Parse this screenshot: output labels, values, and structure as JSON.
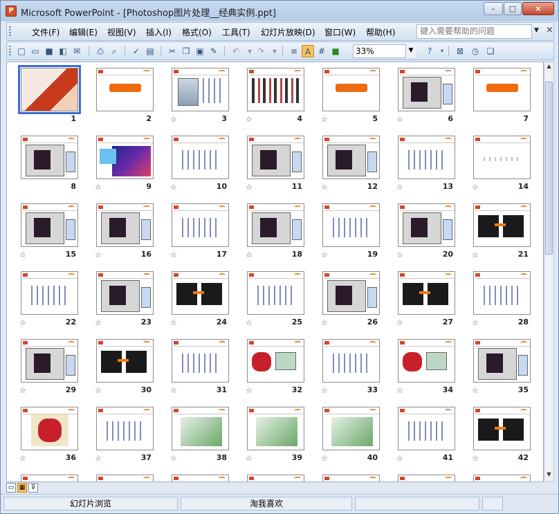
{
  "window": {
    "title": "Microsoft PowerPoint - [Photoshop图片处理__经典实例.ppt]",
    "controls": [
      "–",
      "□",
      "×"
    ]
  },
  "menu": {
    "items": [
      "文件(F)",
      "编辑(E)",
      "视图(V)",
      "插入(I)",
      "格式(O)",
      "工具(T)",
      "幻灯片放映(D)",
      "窗口(W)",
      "帮助(H)"
    ],
    "help_placeholder": "键入需要帮助的问题"
  },
  "toolbar": {
    "zoom": "33%"
  },
  "slides": [
    {
      "n": "1",
      "star": false,
      "kind": "cover",
      "selected": true
    },
    {
      "n": "2",
      "star": false,
      "kind": "banner"
    },
    {
      "n": "3",
      "star": true,
      "kind": "iron"
    },
    {
      "n": "4",
      "star": true,
      "kind": "models"
    },
    {
      "n": "5",
      "star": true,
      "kind": "banner"
    },
    {
      "n": "6",
      "star": true,
      "kind": "screen"
    },
    {
      "n": "7",
      "star": false,
      "kind": "banner"
    },
    {
      "n": "8",
      "star": false,
      "kind": "screen"
    },
    {
      "n": "9",
      "star": true,
      "kind": "colorful"
    },
    {
      "n": "10",
      "star": true,
      "kind": "text"
    },
    {
      "n": "11",
      "star": true,
      "kind": "screen"
    },
    {
      "n": "12",
      "star": true,
      "kind": "screen"
    },
    {
      "n": "13",
      "star": true,
      "kind": "text"
    },
    {
      "n": "14",
      "star": true,
      "kind": "plain"
    },
    {
      "n": "15",
      "star": true,
      "kind": "screen"
    },
    {
      "n": "16",
      "star": true,
      "kind": "screen"
    },
    {
      "n": "17",
      "star": true,
      "kind": "text"
    },
    {
      "n": "18",
      "star": true,
      "kind": "screen"
    },
    {
      "n": "19",
      "star": true,
      "kind": "text"
    },
    {
      "n": "20",
      "star": true,
      "kind": "screen"
    },
    {
      "n": "21",
      "star": true,
      "kind": "shirts"
    },
    {
      "n": "22",
      "star": true,
      "kind": "text"
    },
    {
      "n": "23",
      "star": true,
      "kind": "screen"
    },
    {
      "n": "24",
      "star": true,
      "kind": "shirts"
    },
    {
      "n": "25",
      "star": true,
      "kind": "text"
    },
    {
      "n": "26",
      "star": true,
      "kind": "screen"
    },
    {
      "n": "27",
      "star": true,
      "kind": "shirts"
    },
    {
      "n": "28",
      "star": true,
      "kind": "text"
    },
    {
      "n": "29",
      "star": true,
      "kind": "screen"
    },
    {
      "n": "30",
      "star": true,
      "kind": "shirts"
    },
    {
      "n": "31",
      "star": true,
      "kind": "text"
    },
    {
      "n": "32",
      "star": true,
      "kind": "bag"
    },
    {
      "n": "33",
      "star": true,
      "kind": "text"
    },
    {
      "n": "34",
      "star": true,
      "kind": "bag"
    },
    {
      "n": "35",
      "star": true,
      "kind": "screen"
    },
    {
      "n": "36",
      "star": true,
      "kind": "bagbig"
    },
    {
      "n": "37",
      "star": true,
      "kind": "text"
    },
    {
      "n": "38",
      "star": true,
      "kind": "box"
    },
    {
      "n": "39",
      "star": true,
      "kind": "box"
    },
    {
      "n": "40",
      "star": true,
      "kind": "box"
    },
    {
      "n": "41",
      "star": true,
      "kind": "text"
    },
    {
      "n": "42",
      "star": true,
      "kind": "shirts"
    }
  ],
  "status": {
    "view": "幻灯片浏览",
    "template": "淘我喜欢"
  }
}
